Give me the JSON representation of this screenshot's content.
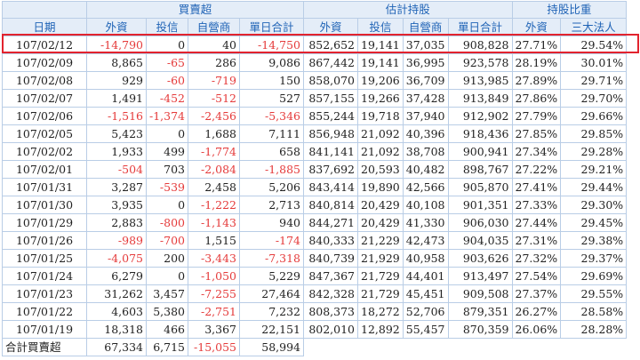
{
  "groups": [
    "買賣超",
    "估計持股",
    "持股比重"
  ],
  "columns": [
    "日期",
    "外資",
    "投信",
    "自營商",
    "單日合計",
    "外資",
    "投信",
    "自營商",
    "單日合計",
    "外資",
    "三大法人"
  ],
  "highlight_color": "#e2232e",
  "negative_color": "#e53b3b",
  "header_text_color": "#1f63b6",
  "rows": [
    [
      "107/02/12",
      "-14,790",
      "0",
      "40",
      "-14,750",
      "852,652",
      "19,141",
      "37,035",
      "908,828",
      "27.71%",
      "29.54%"
    ],
    [
      "107/02/09",
      "8,865",
      "-65",
      "286",
      "9,086",
      "867,442",
      "19,141",
      "36,995",
      "923,578",
      "28.19%",
      "30.01%"
    ],
    [
      "107/02/08",
      "929",
      "-60",
      "-719",
      "150",
      "858,070",
      "19,206",
      "36,709",
      "913,985",
      "27.89%",
      "29.71%"
    ],
    [
      "107/02/07",
      "1,491",
      "-452",
      "-512",
      "527",
      "857,155",
      "19,266",
      "37,428",
      "913,849",
      "27.86%",
      "29.70%"
    ],
    [
      "107/02/06",
      "-1,516",
      "-1,374",
      "-2,456",
      "-5,346",
      "855,244",
      "19,718",
      "37,940",
      "912,902",
      "27.79%",
      "29.66%"
    ],
    [
      "107/02/05",
      "5,423",
      "0",
      "1,688",
      "7,111",
      "856,948",
      "21,092",
      "40,396",
      "918,436",
      "27.85%",
      "29.85%"
    ],
    [
      "107/02/02",
      "1,933",
      "499",
      "-1,774",
      "658",
      "841,141",
      "21,092",
      "38,708",
      "900,941",
      "27.34%",
      "29.28%"
    ],
    [
      "107/02/01",
      "-504",
      "703",
      "-2,084",
      "-1,885",
      "837,692",
      "20,593",
      "40,482",
      "898,767",
      "27.22%",
      "29.21%"
    ],
    [
      "107/01/31",
      "3,287",
      "-539",
      "2,458",
      "5,206",
      "843,414",
      "19,890",
      "42,566",
      "905,870",
      "27.41%",
      "29.44%"
    ],
    [
      "107/01/30",
      "3,935",
      "0",
      "-1,222",
      "2,713",
      "840,814",
      "20,429",
      "40,108",
      "901,351",
      "27.33%",
      "29.30%"
    ],
    [
      "107/01/29",
      "2,883",
      "-800",
      "-1,143",
      "940",
      "844,271",
      "20,429",
      "41,330",
      "906,030",
      "27.44%",
      "29.45%"
    ],
    [
      "107/01/26",
      "-989",
      "-700",
      "1,515",
      "-174",
      "840,333",
      "21,229",
      "42,473",
      "904,035",
      "27.31%",
      "29.38%"
    ],
    [
      "107/01/25",
      "-4,075",
      "200",
      "-3,443",
      "-7,318",
      "840,739",
      "21,929",
      "40,958",
      "903,626",
      "27.32%",
      "29.37%"
    ],
    [
      "107/01/24",
      "6,279",
      "0",
      "-1,050",
      "5,229",
      "847,367",
      "21,729",
      "44,401",
      "913,497",
      "27.54%",
      "29.69%"
    ],
    [
      "107/01/23",
      "31,262",
      "3,457",
      "-7,255",
      "27,464",
      "842,328",
      "21,729",
      "45,451",
      "909,508",
      "27.37%",
      "29.55%"
    ],
    [
      "107/01/22",
      "4,603",
      "5,380",
      "-2,751",
      "7,232",
      "808,373",
      "18,272",
      "52,706",
      "879,351",
      "26.27%",
      "28.58%"
    ],
    [
      "107/01/19",
      "18,318",
      "466",
      "3,367",
      "22,151",
      "802,010",
      "12,892",
      "55,457",
      "870,359",
      "26.06%",
      "28.28%"
    ]
  ],
  "footer": {
    "label": "合計買賣超",
    "values": [
      "67,334",
      "6,715",
      "-15,055",
      "58,994"
    ]
  }
}
